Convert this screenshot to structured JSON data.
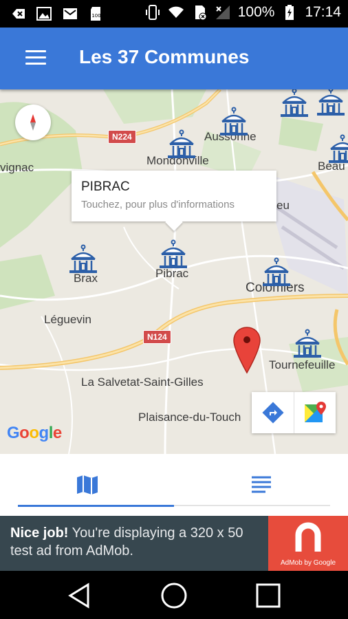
{
  "status_bar": {
    "battery": "100%",
    "time": "17:14",
    "icons": [
      "back-arrow-icon",
      "image-icon",
      "gmail-icon",
      "sd-card-icon",
      "vibrate-icon",
      "wifi-icon",
      "sim-off-icon",
      "signal-icon",
      "battery-charging-icon"
    ]
  },
  "app_bar": {
    "menu_icon": "hamburger-icon",
    "title": "Les 37 Communes",
    "color": "#3a78d8"
  },
  "map": {
    "towns": [
      "vignac",
      "Aussonne",
      "Mondonville",
      "Beau",
      "eu",
      "Brax",
      "Pibrac",
      "Colomiers",
      "Léguevin",
      "Tournefeuille",
      "La Salvetat-Saint-Gilles",
      "Plaisance-du-Touch"
    ],
    "road_shields": [
      "N224",
      "N124"
    ],
    "callout": {
      "title": "PIBRAC",
      "subtitle": "Touchez, pour plus d'informations"
    },
    "markers_icon": "town-hall-icon",
    "selected_marker_icon": "map-pin-icon",
    "compass_icon": "compass-icon",
    "tools": [
      "directions-icon",
      "google-maps-icon"
    ],
    "attribution": "Google"
  },
  "tabs": [
    {
      "icon": "map-icon",
      "selected": true
    },
    {
      "icon": "list-icon",
      "selected": false
    }
  ],
  "ad": {
    "bold": "Nice job!",
    "text": " You're displaying a 320 x 50 test ad from AdMob.",
    "badge_label": "AdMob by Google",
    "badge_color": "#e74c3c"
  },
  "nav_bar": [
    "back-icon",
    "home-icon",
    "recents-icon"
  ]
}
